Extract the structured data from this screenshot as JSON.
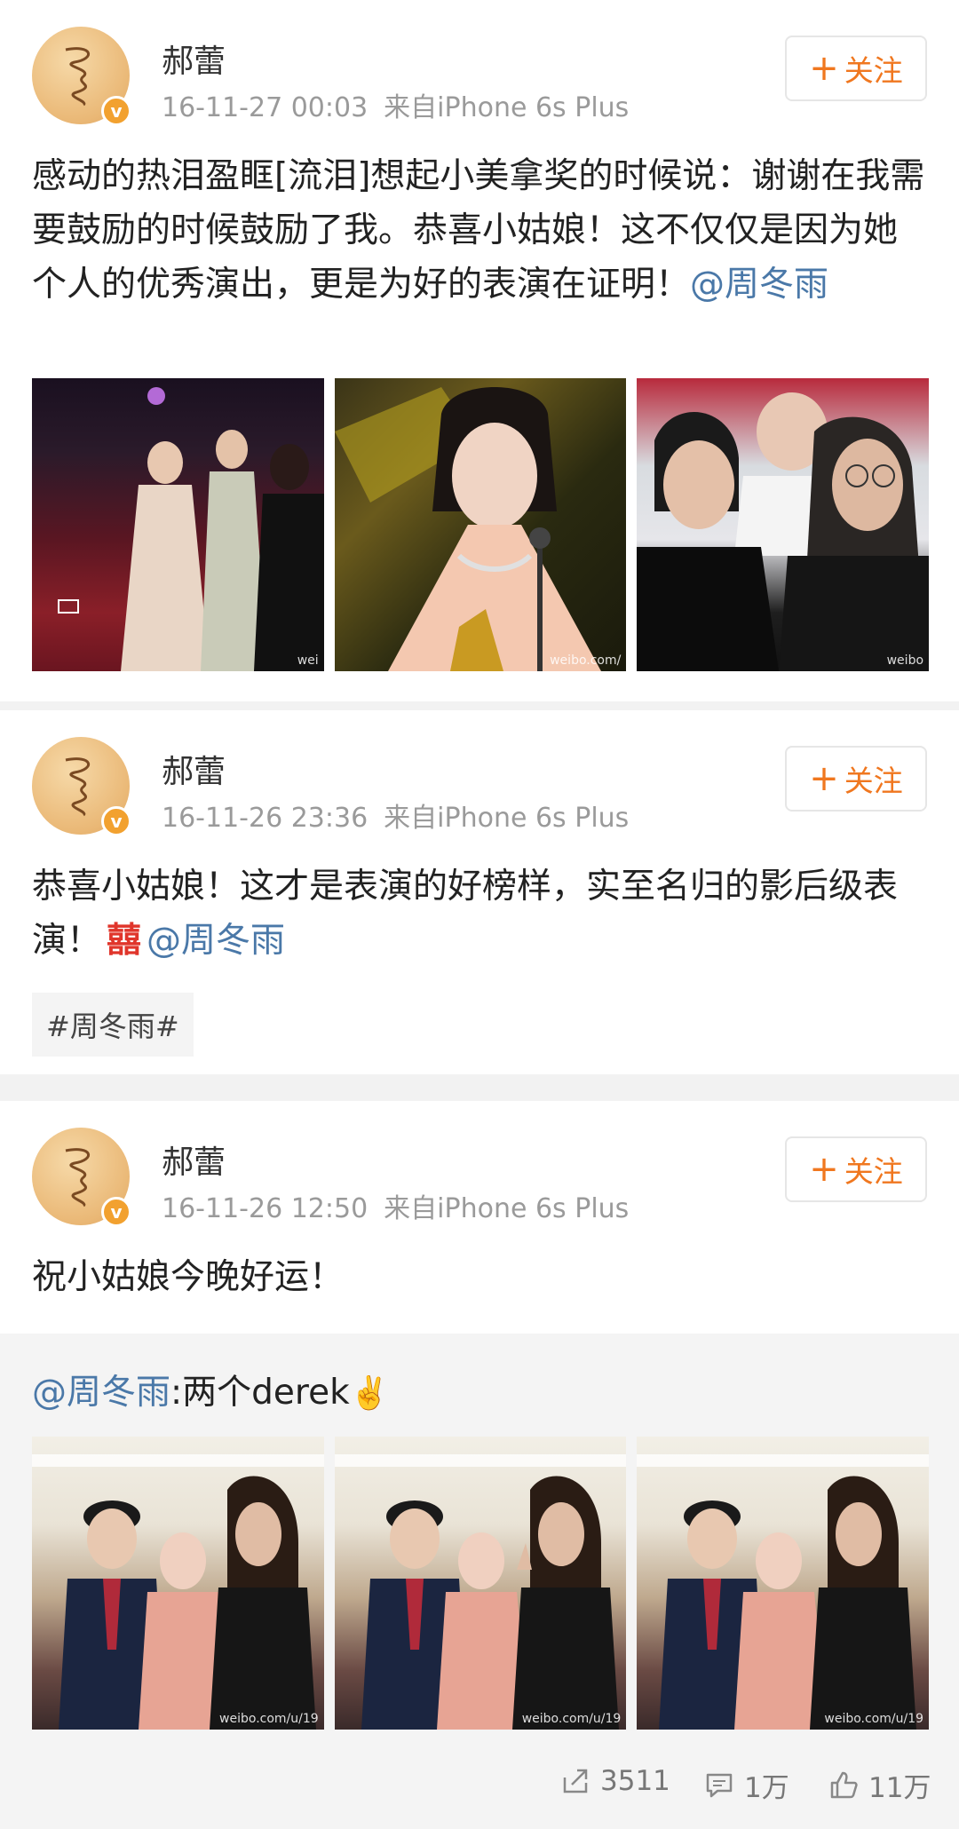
{
  "posts": [
    {
      "name": "郝蕾",
      "time": "16-11-27 00:03",
      "source": "来自iPhone 6s Plus",
      "follow_label": "关注",
      "text_main": "感动的热泪盈眶[流泪]想起小美拿奖的时候说：谢谢在我需要鼓励的时候鼓励了我。恭喜小姑娘！这不仅仅是因为她个人的优秀演出，更是为好的表演在证明！",
      "mention": "@周冬雨",
      "photos": [
        {
          "alt": "red carpet photo",
          "watermark": "wei"
        },
        {
          "alt": "award speech photo",
          "watermark": "weibo.com/"
        },
        {
          "alt": "audience photo",
          "watermark": "weibo"
        }
      ]
    },
    {
      "name": "郝蕾",
      "time": "16-11-26 23:36",
      "source": "来自iPhone 6s Plus",
      "follow_label": "关注",
      "text_main": "恭喜小姑娘！这才是表演的好榜样，实至名归的影后级表演！",
      "emoji": "囍",
      "mention": "@周冬雨",
      "tag": "#周冬雨#"
    },
    {
      "name": "郝蕾",
      "time": "16-11-26 12:50",
      "source": "来自iPhone 6s Plus",
      "follow_label": "关注",
      "text_main": "祝小姑娘今晚好运！",
      "repost": {
        "mention": "@周冬雨",
        "text": ":两个derek",
        "emoji": "✌️",
        "photos": [
          {
            "alt": "group photo 1",
            "watermark": "weibo.com/u/19"
          },
          {
            "alt": "group photo 2",
            "watermark": "weibo.com/u/19"
          },
          {
            "alt": "group photo 3",
            "watermark": "weibo.com/u/19"
          }
        ],
        "actions": {
          "share_count": "3511",
          "comment_count": "1万",
          "like_count": "11万"
        }
      }
    }
  ]
}
